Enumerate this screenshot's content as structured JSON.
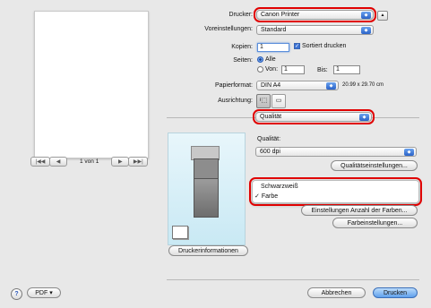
{
  "preview": {
    "first_label": "|◀◀",
    "prev_label": "◀",
    "page_text": "1 von 1",
    "next_label": "▶",
    "last_label": "▶▶|"
  },
  "printer": {
    "label": "Drucker:",
    "value": "Canon Printer"
  },
  "presets": {
    "label": "Voreinstellungen:",
    "value": "Standard"
  },
  "copies": {
    "label": "Kopien:",
    "value": "1",
    "collate_label": "Sortiert drucken",
    "collate_checked": true
  },
  "pages": {
    "label": "Seiten:",
    "all_label": "Alle",
    "from_label": "Von:",
    "from_value": "1",
    "to_label": "Bis:",
    "to_value": "1"
  },
  "paper": {
    "label": "Papierformat:",
    "value": "DIN A4",
    "size": "20.99 x 29.70 cm"
  },
  "orientation": {
    "label": "Ausrichtung:"
  },
  "panel_select": {
    "value": "Qualität"
  },
  "quality": {
    "label": "Qualität:",
    "value": "600 dpi",
    "settings_button": "Qualitätseinstellungen...",
    "color_options": [
      "Schwarzweiß",
      "Farbe"
    ],
    "selected_color": "Farbe",
    "colors_count_button": "Einstellungen Anzahl der Farben...",
    "color_settings_button": "Farbeinstellungen..."
  },
  "printer_info_button": "Druckerinformationen",
  "help_label": "?",
  "pdf_button": "PDF ▾",
  "cancel_button": "Abbrechen",
  "print_button": "Drucken"
}
